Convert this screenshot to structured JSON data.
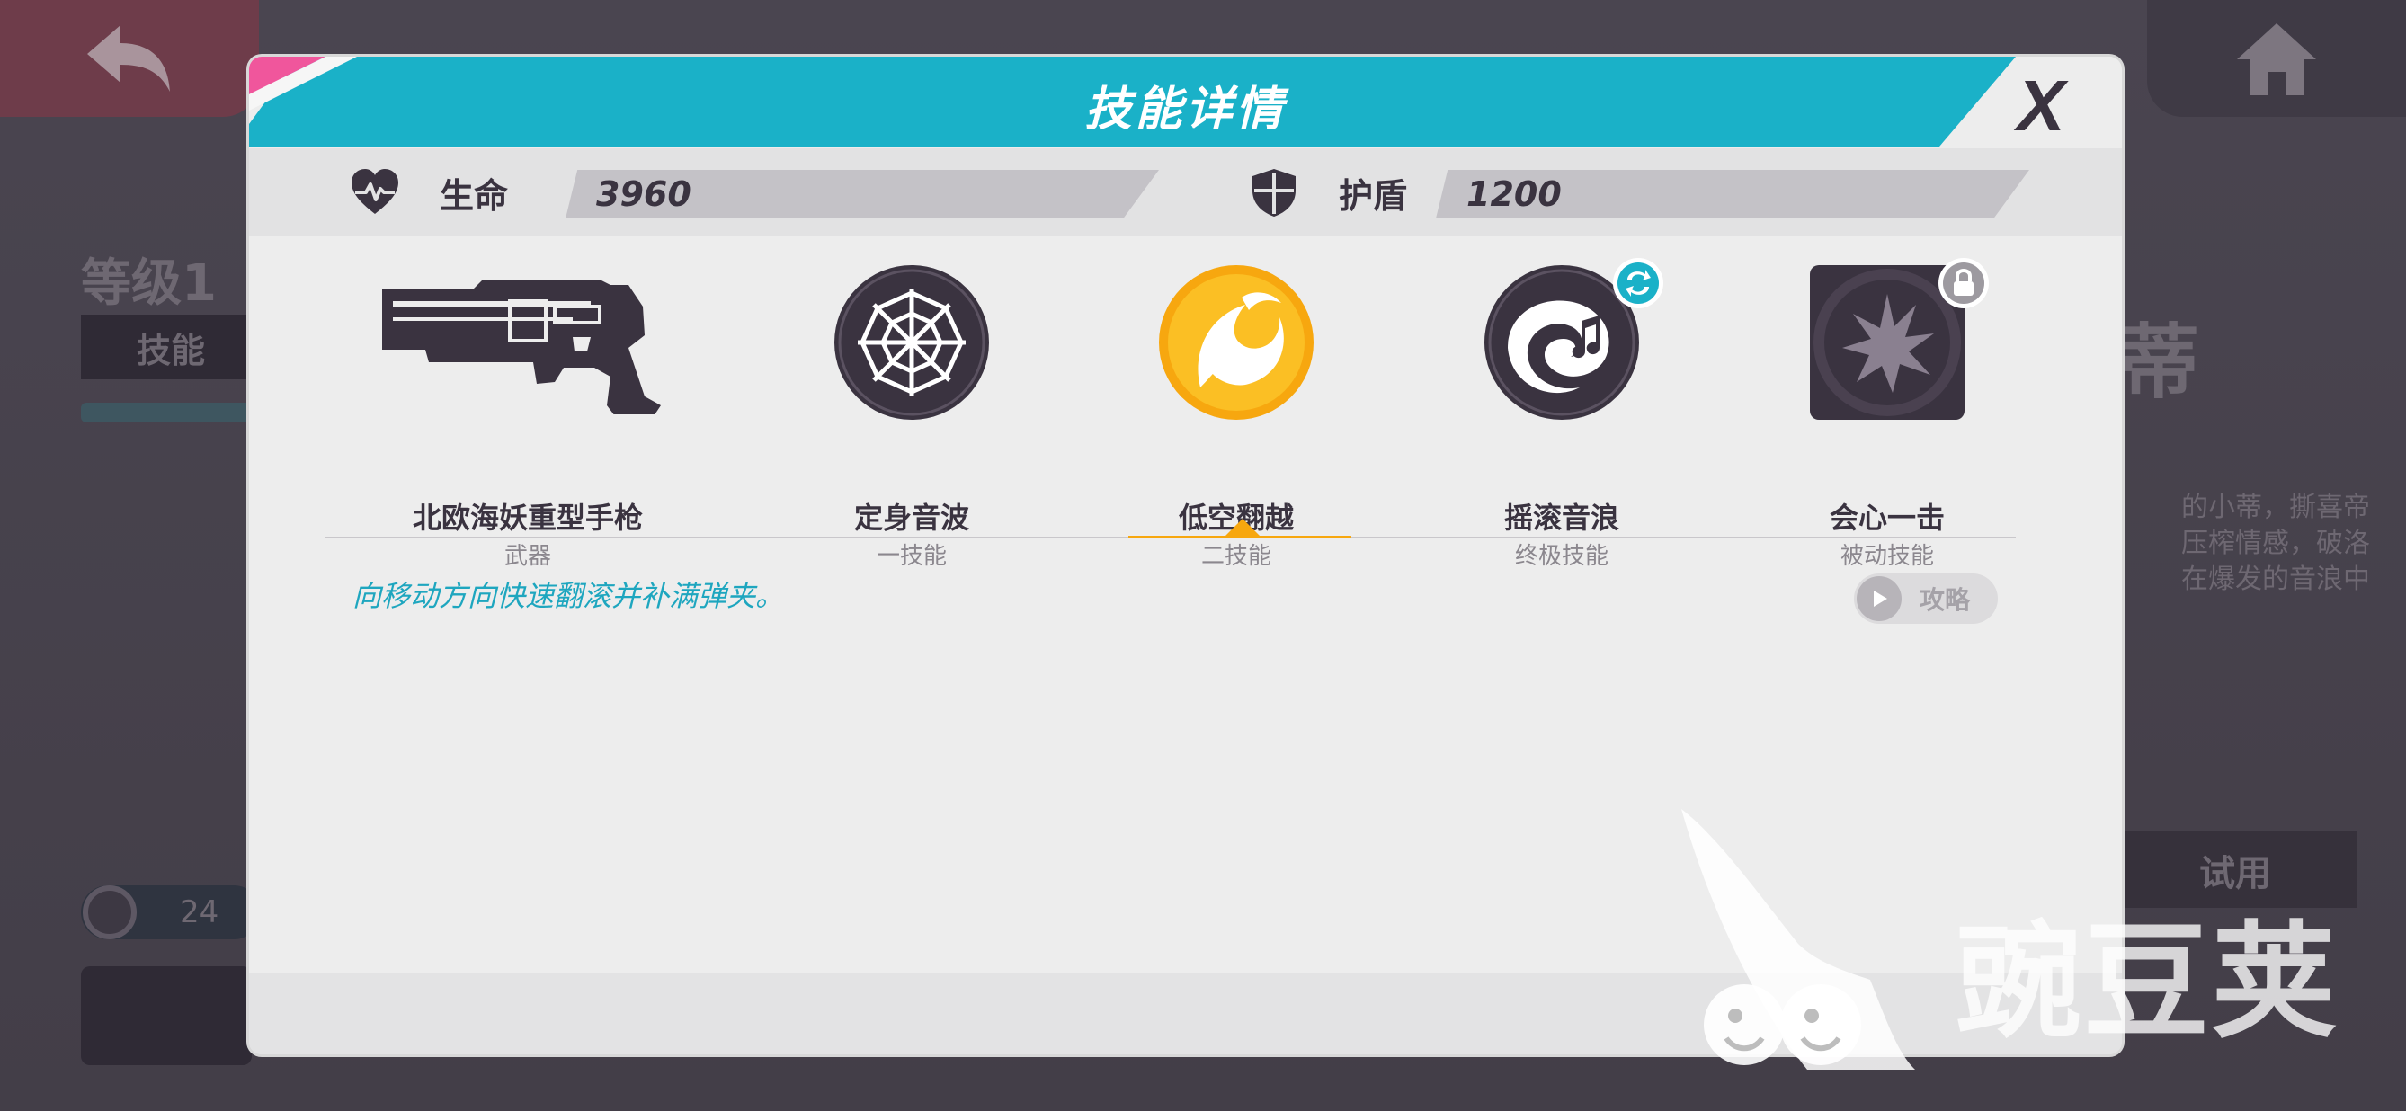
{
  "background": {
    "level_text": "等级1",
    "skill_tab": "技能",
    "right_title": "蒂",
    "right_text": [
      "的小蒂，撕喜帝",
      "压榨情感，破洛",
      "在爆发的音浪中"
    ],
    "resource_value": "24",
    "trial_label": "试用"
  },
  "modal": {
    "title": "技能详情",
    "close_symbol": "X",
    "stats": {
      "hp_label": "生命",
      "hp_value": "3960",
      "shield_label": "护盾",
      "shield_value": "1200"
    },
    "skills": [
      {
        "name": "北欧海妖重型手枪",
        "type": "武器",
        "icon": "pistol-icon",
        "selected": false
      },
      {
        "name": "定身音波",
        "type": "一技能",
        "icon": "spiderweb-icon",
        "selected": false
      },
      {
        "name": "低空翻越",
        "type": "二技能",
        "icon": "wind-swirl-icon",
        "selected": true
      },
      {
        "name": "摇滚音浪",
        "type": "终极技能",
        "icon": "sound-wave-icon",
        "selected": false,
        "badge": "swap-icon"
      },
      {
        "name": "会心一击",
        "type": "被动技能",
        "icon": "burst-icon",
        "selected": false,
        "badge": "lock-icon"
      }
    ],
    "description": "向移动方向快速翻滚并补满弹夹。",
    "guide_label": "攻略"
  },
  "watermark": {
    "text": "豌豆荚"
  },
  "colors": {
    "accent_cyan": "#1ab1c8",
    "accent_pink": "#f0569c",
    "accent_orange": "#f7a70f",
    "icon_dark": "#3a3340",
    "panel_bg": "#ededed"
  }
}
